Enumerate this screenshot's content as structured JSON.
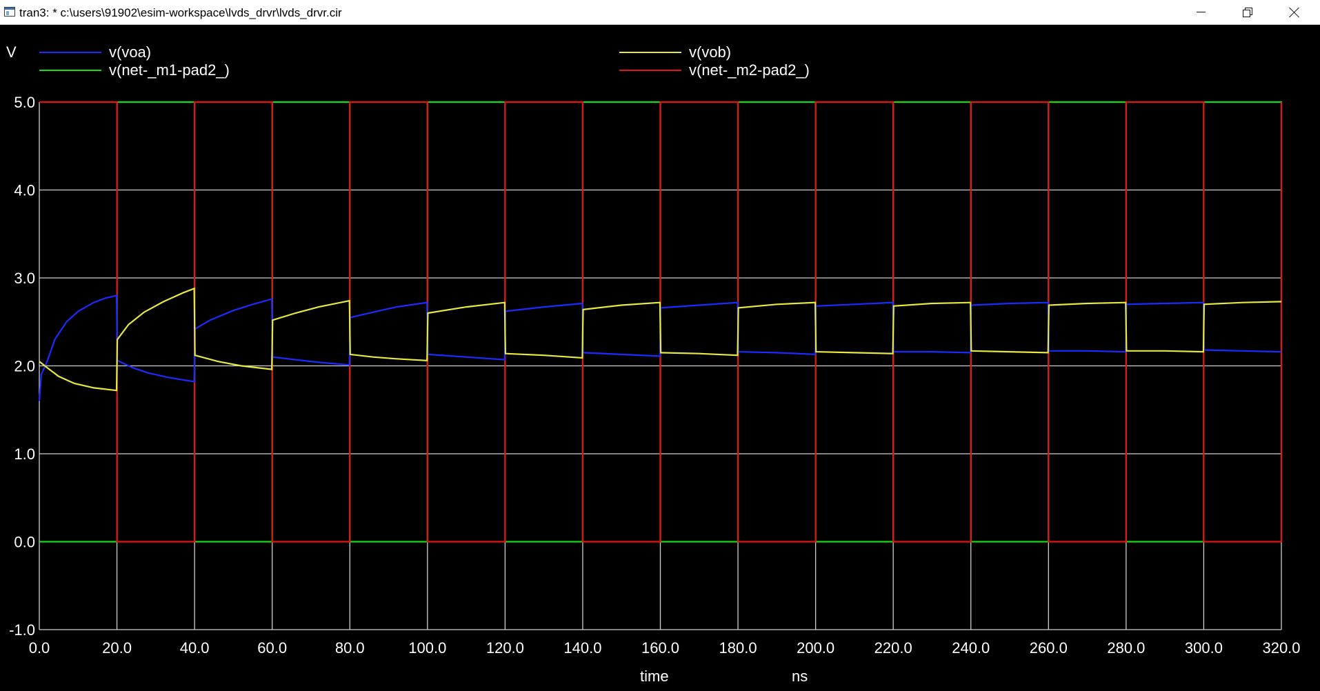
{
  "window": {
    "title": "tran3: * c:\\users\\91902\\esim-workspace\\lvds_drvr\\lvds_drvr.cir"
  },
  "chart_data": {
    "type": "line",
    "ylabel": "V",
    "xlabel": "time",
    "xunit": "ns",
    "xlim": [
      0,
      320
    ],
    "ylim": [
      -1,
      5
    ],
    "grid": true,
    "legend_position": "top",
    "x_ticks": [
      "0.0",
      "20.0",
      "40.0",
      "60.0",
      "80.0",
      "100.0",
      "120.0",
      "140.0",
      "160.0",
      "180.0",
      "200.0",
      "220.0",
      "240.0",
      "260.0",
      "280.0",
      "300.0",
      "320.0"
    ],
    "y_ticks": [
      "5.0",
      "4.0",
      "3.0",
      "2.0",
      "1.0",
      "0.0",
      "-1.0"
    ],
    "series": [
      {
        "name": "v(voa)",
        "color": "#1a2cff",
        "points": [
          [
            0,
            1.6
          ],
          [
            0.5,
            1.9
          ],
          [
            2,
            2.05
          ],
          [
            4,
            2.3
          ],
          [
            7,
            2.5
          ],
          [
            10,
            2.62
          ],
          [
            14,
            2.72
          ],
          [
            17,
            2.77
          ],
          [
            19.9,
            2.8
          ],
          [
            20.1,
            2.06
          ],
          [
            24,
            1.98
          ],
          [
            28,
            1.92
          ],
          [
            33,
            1.87
          ],
          [
            39.9,
            1.82
          ],
          [
            40.1,
            2.42
          ],
          [
            44,
            2.52
          ],
          [
            50,
            2.63
          ],
          [
            55,
            2.7
          ],
          [
            59.9,
            2.76
          ],
          [
            60.1,
            2.1
          ],
          [
            66,
            2.07
          ],
          [
            72,
            2.04
          ],
          [
            79.9,
            2.01
          ],
          [
            80.1,
            2.55
          ],
          [
            86,
            2.61
          ],
          [
            92,
            2.67
          ],
          [
            99.9,
            2.72
          ],
          [
            100.1,
            2.13
          ],
          [
            110,
            2.1
          ],
          [
            119.9,
            2.07
          ],
          [
            120.1,
            2.62
          ],
          [
            130,
            2.67
          ],
          [
            139.9,
            2.71
          ],
          [
            140.1,
            2.15
          ],
          [
            150,
            2.13
          ],
          [
            159.9,
            2.11
          ],
          [
            160.1,
            2.66
          ],
          [
            170,
            2.69
          ],
          [
            179.9,
            2.72
          ],
          [
            180.1,
            2.16
          ],
          [
            190,
            2.15
          ],
          [
            199.9,
            2.13
          ],
          [
            200.1,
            2.68
          ],
          [
            210,
            2.7
          ],
          [
            219.9,
            2.72
          ],
          [
            220.1,
            2.16
          ],
          [
            230,
            2.16
          ],
          [
            239.9,
            2.15
          ],
          [
            240.1,
            2.69
          ],
          [
            250,
            2.71
          ],
          [
            259.9,
            2.72
          ],
          [
            260.1,
            2.17
          ],
          [
            270,
            2.17
          ],
          [
            279.9,
            2.16
          ],
          [
            280.1,
            2.7
          ],
          [
            290,
            2.71
          ],
          [
            299.9,
            2.72
          ],
          [
            300.1,
            2.18
          ],
          [
            310,
            2.17
          ],
          [
            320,
            2.16
          ]
        ]
      },
      {
        "name": "v(vob)",
        "color": "#e8e840",
        "points": [
          [
            0,
            2.05
          ],
          [
            2,
            1.98
          ],
          [
            5,
            1.88
          ],
          [
            9,
            1.8
          ],
          [
            14,
            1.75
          ],
          [
            19.9,
            1.72
          ],
          [
            20.1,
            2.3
          ],
          [
            23,
            2.47
          ],
          [
            27,
            2.61
          ],
          [
            32,
            2.73
          ],
          [
            37,
            2.83
          ],
          [
            39.9,
            2.88
          ],
          [
            40.1,
            2.12
          ],
          [
            46,
            2.05
          ],
          [
            52,
            2.0
          ],
          [
            59.9,
            1.96
          ],
          [
            60.1,
            2.52
          ],
          [
            66,
            2.6
          ],
          [
            72,
            2.67
          ],
          [
            79.9,
            2.74
          ],
          [
            80.1,
            2.13
          ],
          [
            86,
            2.1
          ],
          [
            92,
            2.08
          ],
          [
            99.9,
            2.06
          ],
          [
            100.1,
            2.6
          ],
          [
            110,
            2.67
          ],
          [
            119.9,
            2.72
          ],
          [
            120.1,
            2.14
          ],
          [
            130,
            2.12
          ],
          [
            139.9,
            2.09
          ],
          [
            140.1,
            2.64
          ],
          [
            150,
            2.69
          ],
          [
            159.9,
            2.72
          ],
          [
            160.1,
            2.15
          ],
          [
            170,
            2.14
          ],
          [
            179.9,
            2.12
          ],
          [
            180.1,
            2.66
          ],
          [
            190,
            2.7
          ],
          [
            199.9,
            2.72
          ],
          [
            200.1,
            2.16
          ],
          [
            210,
            2.15
          ],
          [
            219.9,
            2.14
          ],
          [
            220.1,
            2.68
          ],
          [
            230,
            2.71
          ],
          [
            239.9,
            2.72
          ],
          [
            240.1,
            2.17
          ],
          [
            250,
            2.16
          ],
          [
            259.9,
            2.15
          ],
          [
            260.1,
            2.69
          ],
          [
            270,
            2.71
          ],
          [
            279.9,
            2.72
          ],
          [
            280.1,
            2.17
          ],
          [
            290,
            2.17
          ],
          [
            299.9,
            2.16
          ],
          [
            300.1,
            2.7
          ],
          [
            310,
            2.72
          ],
          [
            320,
            2.73
          ]
        ]
      },
      {
        "name": "v(net-_m1-pad2_)",
        "color": "#14dc14",
        "period_ns": 40,
        "high_ns": [
          20,
          40
        ],
        "low_v": 0,
        "high_v": 5
      },
      {
        "name": "v(net-_m2-pad2_)",
        "color": "#e41414",
        "period_ns": 40,
        "high_ns": [
          0,
          20
        ],
        "low_v": 0,
        "high_v": 5
      }
    ]
  }
}
